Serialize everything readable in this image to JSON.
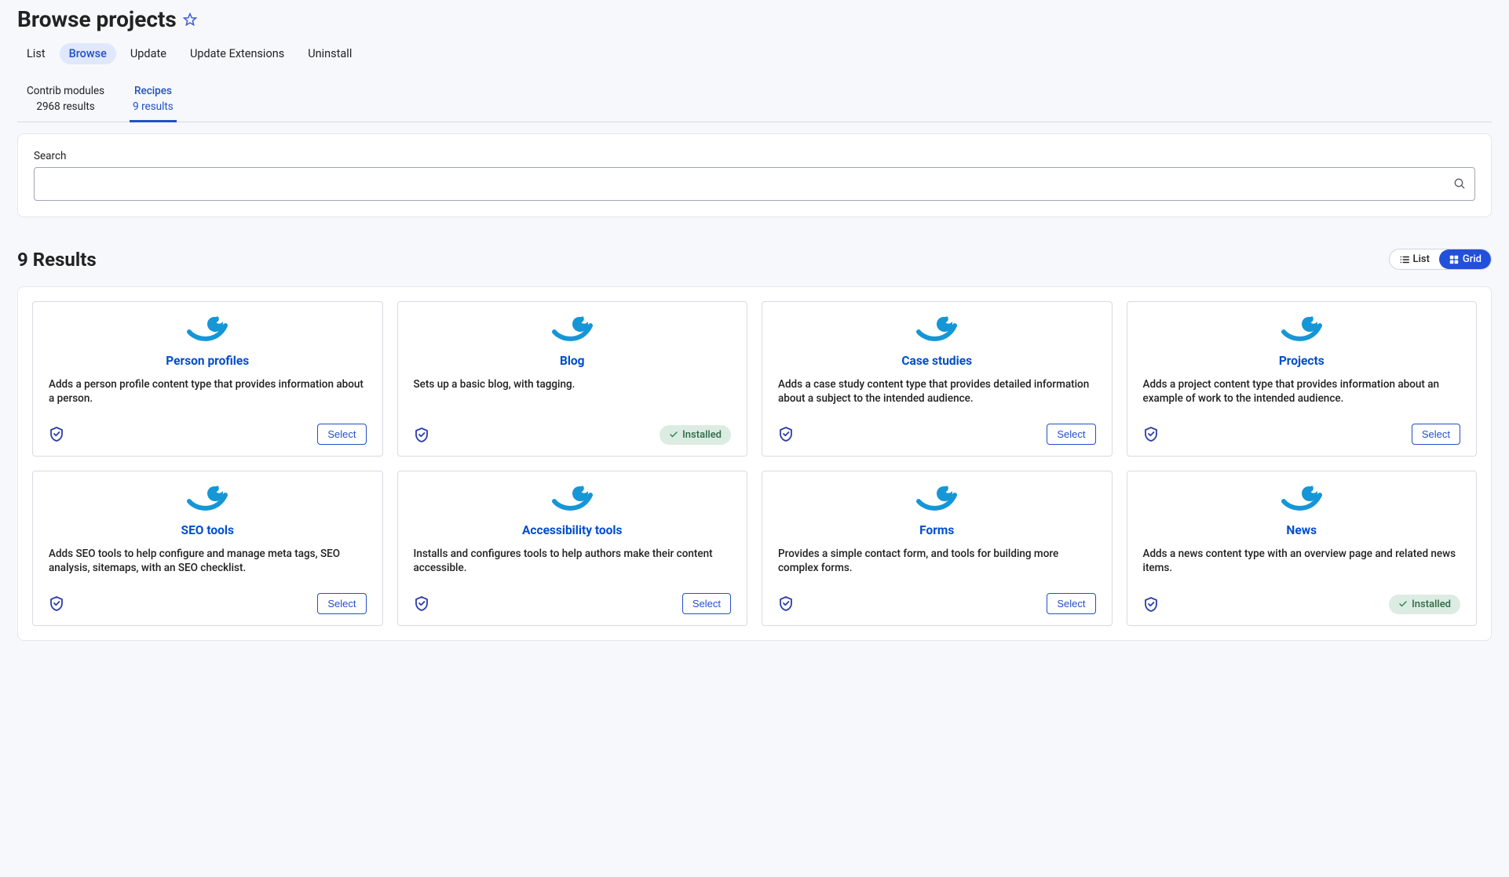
{
  "page_title": "Browse projects",
  "primary_tabs": [
    {
      "label": "List",
      "active": false
    },
    {
      "label": "Browse",
      "active": true
    },
    {
      "label": "Update",
      "active": false
    },
    {
      "label": "Update Extensions",
      "active": false
    },
    {
      "label": "Uninstall",
      "active": false
    }
  ],
  "secondary_tabs": [
    {
      "name": "Contrib modules",
      "count": "2968 results",
      "active": false
    },
    {
      "name": "Recipes",
      "count": "9 results",
      "active": true
    }
  ],
  "search": {
    "label": "Search",
    "value": ""
  },
  "results_heading": "9 Results",
  "view_toggle": {
    "list_label": "List",
    "grid_label": "Grid",
    "active": "grid"
  },
  "select_label": "Select",
  "installed_label": "Installed",
  "cards": [
    {
      "title": "Person profiles",
      "desc": "Adds a person profile content type that provides informa­tion about a person.",
      "status": "select"
    },
    {
      "title": "Blog",
      "desc": "Sets up a basic blog, with tagging.",
      "status": "installed"
    },
    {
      "title": "Case studies",
      "desc": "Adds a case study content type that provides detailed in­formation about a subject to the intended audience.",
      "status": "select"
    },
    {
      "title": "Projects",
      "desc": "Adds a project content type that provides information about an example of work to the intended audience.",
      "status": "select"
    },
    {
      "title": "SEO tools",
      "desc": "Adds SEO tools to help configure and manage meta tags, SEO analysis, sitemaps, with an SEO checklist.",
      "status": "select"
    },
    {
      "title": "Accessibility tools",
      "desc": "Installs and configures tools to help authors make their content accessible.",
      "status": "select"
    },
    {
      "title": "Forms",
      "desc": "Provides a simple contact form, and tools for building more complex forms.",
      "status": "select"
    },
    {
      "title": "News",
      "desc": "Adds a news content type with an overview page and re­lated news items.",
      "status": "installed"
    }
  ]
}
